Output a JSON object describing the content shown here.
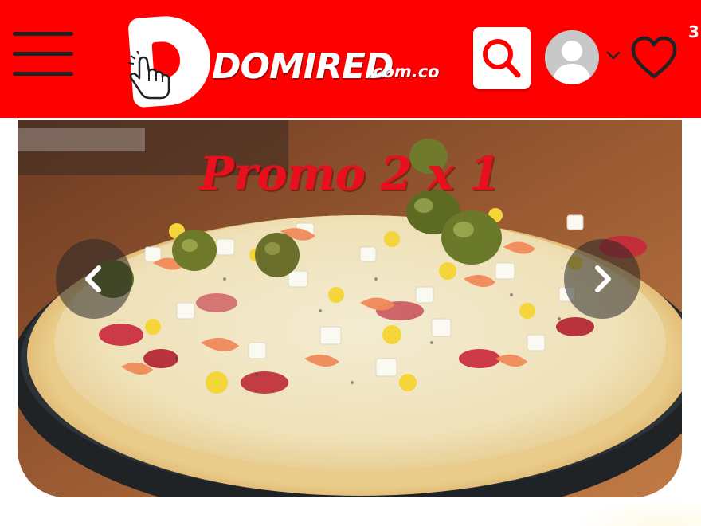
{
  "header": {
    "brand_main": "DOMIRED",
    "brand_tld": ".com.co",
    "cart_count": "3",
    "colors": {
      "accent": "#ff0000",
      "icon_dark": "#222222",
      "white": "#ffffff"
    },
    "icons": [
      "menu-icon",
      "search-icon",
      "user-avatar-icon",
      "chevron-down-icon",
      "heart-icon"
    ]
  },
  "banner": {
    "title": "Promo 2 x 1",
    "image": "pizza-photo",
    "controls": [
      "chevron-left-icon",
      "chevron-right-icon"
    ],
    "title_color": "#e8101c"
  }
}
